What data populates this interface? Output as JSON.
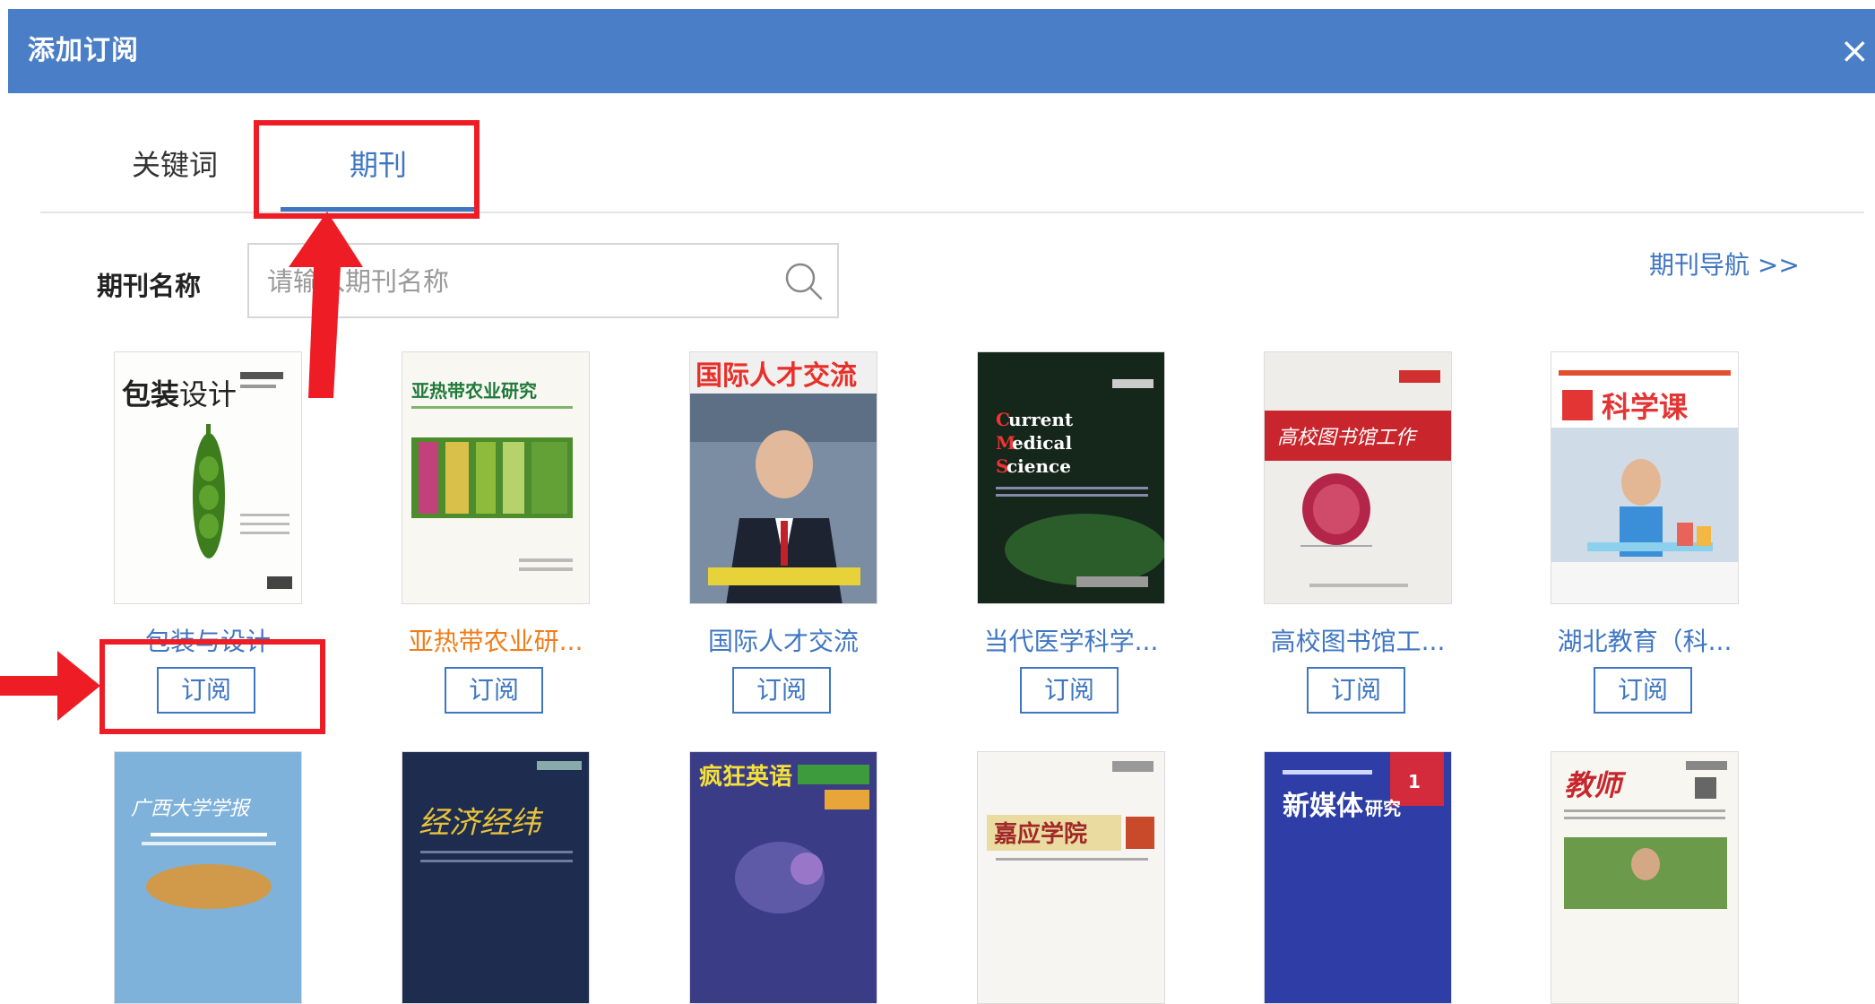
{
  "dialog": {
    "title": "添加订阅",
    "close_icon": "×"
  },
  "tabs": [
    {
      "label": "关键词",
      "active": false
    },
    {
      "label": "期刊",
      "active": true
    }
  ],
  "search": {
    "label": "期刊名称",
    "placeholder": "请输入期刊名称",
    "icon": "search-icon"
  },
  "nav_link": "期刊导航 >>",
  "subscribe_label": "订阅",
  "journals_row1": [
    {
      "title": "包装与设计",
      "cover_text": "包装&设计"
    },
    {
      "title": "亚热带农业研...",
      "cover_text": "亚热带农业研究"
    },
    {
      "title": "国际人才交流",
      "cover_text": "国际人才交流"
    },
    {
      "title": "当代医学科学...",
      "cover_text": "Current Medical Science"
    },
    {
      "title": "高校图书馆工...",
      "cover_text": "高校图书馆工作"
    },
    {
      "title": "湖北教育（科...",
      "cover_text": "科学课"
    }
  ],
  "journals_row2": [
    {
      "cover_text": "广西大学学报"
    },
    {
      "cover_text": "经济经纬"
    },
    {
      "cover_text": "疯狂英语"
    },
    {
      "cover_text": "嘉应学院"
    },
    {
      "cover_text": "新媒体研究"
    },
    {
      "cover_text": "教师"
    }
  ],
  "colors": {
    "titlebar": "#4a7fc7",
    "accent": "#3f76c2",
    "highlight_box": "#ee1c25",
    "orange_title": "#ef7d1a"
  }
}
